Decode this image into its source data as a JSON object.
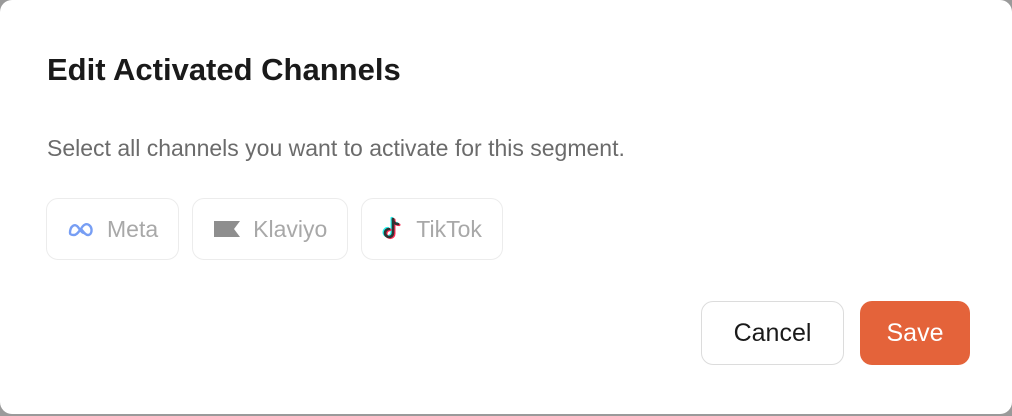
{
  "dialog": {
    "title": "Edit Activated Channels",
    "description": "Select all channels you want to activate for this segment."
  },
  "channels": [
    {
      "label": "Meta",
      "icon": "meta-icon",
      "selected": false
    },
    {
      "label": "Klaviyo",
      "icon": "klaviyo-icon",
      "selected": false
    },
    {
      "label": "TikTok",
      "icon": "tiktok-icon",
      "selected": false
    }
  ],
  "actions": {
    "cancel_label": "Cancel",
    "save_label": "Save"
  },
  "colors": {
    "accent": "#e4633a",
    "meta_blue": "#4a7ef0",
    "tiktok_cyan": "#25f4ee",
    "tiktok_red": "#fe2c55"
  }
}
